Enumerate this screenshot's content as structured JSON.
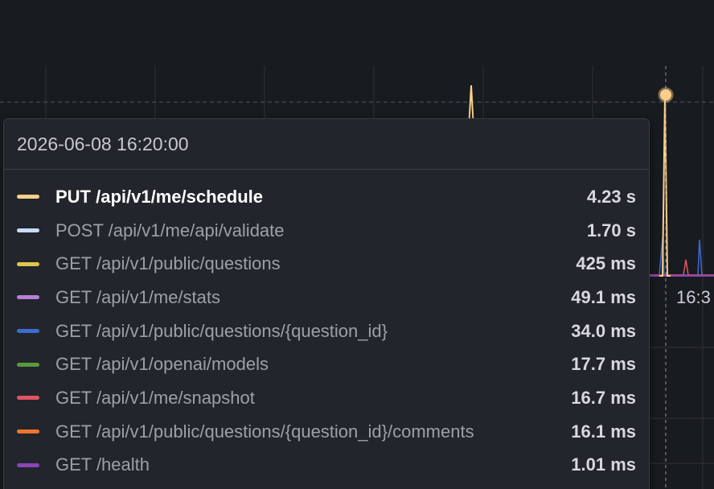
{
  "chart": {
    "x_tick_partial": "16:3",
    "colors": {
      "background": "#181b1f",
      "grid": "#2f3237",
      "threshold": "#55585e",
      "hover_line": "#8e8f96",
      "main_series": "#fbcf8a"
    }
  },
  "tooltip": {
    "timestamp": "2026-06-08 16:20:00",
    "rows": [
      {
        "label": "PUT /api/v1/me/schedule",
        "value": "4.23 s",
        "color": "#fbcf8a",
        "active": true
      },
      {
        "label": "POST /api/v1/me/api/validate",
        "value": "1.70 s",
        "color": "#c9dbff",
        "active": false
      },
      {
        "label": "GET /api/v1/public/questions",
        "value": "425 ms",
        "color": "#e0c44b",
        "active": false
      },
      {
        "label": "GET /api/v1/me/stats",
        "value": "49.1 ms",
        "color": "#b97fd6",
        "active": false
      },
      {
        "label": "GET /api/v1/public/questions/{question_id}",
        "value": "34.0 ms",
        "color": "#3d6bd1",
        "active": false
      },
      {
        "label": "GET /api/v1/openai/models",
        "value": "17.7 ms",
        "color": "#5b9a3b",
        "active": false
      },
      {
        "label": "GET /api/v1/me/snapshot",
        "value": "16.7 ms",
        "color": "#e05561",
        "active": false
      },
      {
        "label": "GET /api/v1/public/questions/{question_id}/comments",
        "value": "16.1 ms",
        "color": "#ee7530",
        "active": false
      },
      {
        "label": "GET /health",
        "value": "1.01 ms",
        "color": "#8a45b5",
        "active": false
      }
    ]
  }
}
